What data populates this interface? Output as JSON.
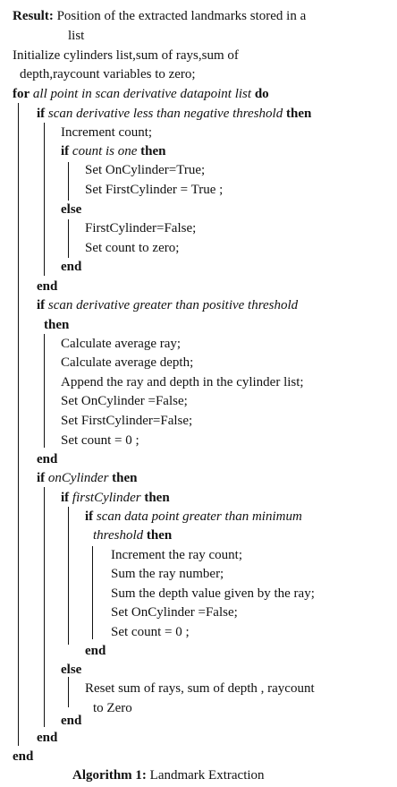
{
  "algorithm": {
    "result_kw": "Result:",
    "result_1": "Position of the extracted landmarks stored in a",
    "result_2": "list",
    "init_1": "Initialize cylinders list,sum of rays,sum of",
    "init_2": "depth,raycount variables to zero;",
    "for_kw": "for",
    "for_cond": "all point in scan derivative datapoint list",
    "do_kw": "do",
    "if_kw": "if",
    "then_kw": "then",
    "else_kw": "else",
    "end_kw": "end",
    "if1_cond": "scan derivative less than negative threshold",
    "increment_count": "Increment count;",
    "if2_cond": "count is one",
    "set_oncyl_true": "Set OnCylinder=True;",
    "set_firstcyl_true": "Set FirstCylinder = True ;",
    "firstcyl_false_a": "FirstCylinder=False;",
    "set_count_zero": "Set count to zero;",
    "if3_cond": "scan derivative greater than positive threshold",
    "calc_avg_ray": "Calculate average ray;",
    "calc_avg_depth": "Calculate average depth;",
    "append_ray": "Append the ray and depth in the cylinder list;",
    "set_oncyl_false_a": "Set OnCylinder =False;",
    "set_firstcyl_false": "Set FirstCylinder=False;",
    "set_count_0_a": "Set count = 0 ;",
    "if4_cond": "onCylinder",
    "if5_cond": "firstCylinder",
    "if6_cond_1": "scan data point greater than minimum",
    "if6_cond_2": "threshold",
    "inc_ray_count": "Increment the ray count;",
    "sum_ray_number": "Sum the ray number;",
    "sum_depth": "Sum the depth value given by the ray;",
    "set_oncyl_false_b": "Set OnCylinder =False;",
    "set_count_0_b": "Set count = 0 ;",
    "reset_1": "Reset sum of rays, sum of depth , raycount",
    "reset_2": "to Zero",
    "caption_label": "Algorithm 1:",
    "caption_text": "Landmark Extraction"
  }
}
